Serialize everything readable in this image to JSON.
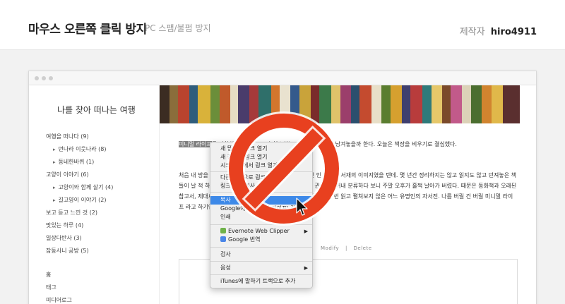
{
  "header": {
    "title": "마우스 오른쪽 클릭 방지",
    "subtitle": "PC 스팸/불펌 방지",
    "maker_label": "제작자",
    "maker_name": "hiro4911"
  },
  "sidebar": {
    "blog_title": "나를 찾아 떠나는 여행",
    "categories": [
      "여행을 떠나다 (9)",
      "먼나라 이웃나라 (8)",
      "동네한바퀴 (1)",
      "고양이 이야기 (6)",
      "고양이와 함께 살기 (4)",
      "길고양이 이야기 (2)",
      "보고 듣고 느낀 것 (2)",
      "맛있는 하루 (4)",
      "일상다반사 (3)",
      "잡동사니 공방 (5)"
    ],
    "links": [
      "홈",
      "태그",
      "미디어로그"
    ]
  },
  "content": {
    "para1_highlight": "미니멀 라이프",
    "para1_rest": "를 지향하고 있었다. 고자 청소하는 과정을 하나하나 남겨놓을까 한다. 오늘은 책장을 비우기로 결심했다.",
    "para2": "처음 내 방을 정리하려고 마음 먹었을 때 가장 먼저 떠올린 인 모습은 서재의 이미지였을 텐데. 몇 년간 정리하지는 않고 읽지도 않고 던져놓은 책들이 날 적 하는 동안 자리만 차지하고 있는 건 로 책을 한 권 두 권 꺼내 분류하다 보니 주말 오후가 홀쩍 날아가 버렸다. 때문은 동화책과 오래된 참고서, 제대로 펼쳐보지도 않은 잡 추억을 당하는 숙제 때문에 한 번 읽고 펼쳐보지 않은 어느 유명인의 자서전. 나름 버릴 건 버릴 미니멀 라이프 라고 하기엔 아직 남은 것이 너무 많을 줄이야.",
    "modify": "Modify",
    "divider": "|",
    "delete": "Delete"
  },
  "context_menu": {
    "items": [
      "새 탭에서 링크 열기",
      "새 창에서 링크 열기",
      "시크릿 창에서 링크 열기",
      "다른 이름으로 링크 저장...",
      "링크 주소 복사",
      "복사",
      "Google에서 '미니멀 라이프' 검색",
      "인쇄",
      "Evernote Web Clipper",
      "Google 번역",
      "검사",
      "음성",
      "iTunes에 말하기 트랙으로 추가"
    ]
  },
  "colors": {
    "ban_red": "#e8401f",
    "menu_highlight": "#3d89e8",
    "backdrop": "#f2f2f2"
  },
  "icons": [
    "evernote-icon",
    "google-translate-icon",
    "prohibition-icon",
    "mouse-cursor-icon"
  ]
}
